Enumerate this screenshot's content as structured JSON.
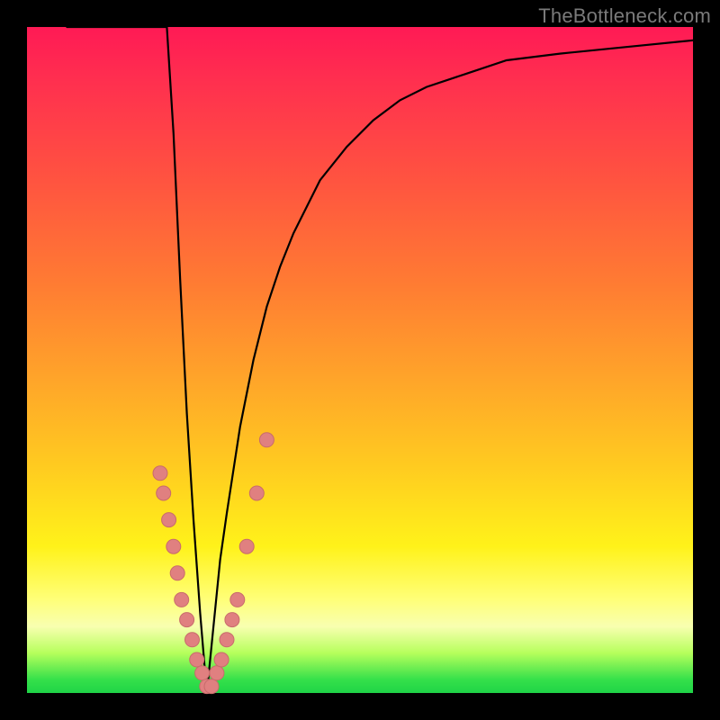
{
  "watermark": "TheBottleneck.com",
  "colors": {
    "curve": "#000000",
    "dot_fill": "#e08080",
    "dot_stroke": "#c86b6b",
    "gradient_stops": [
      "#ff1a55",
      "#ff5141",
      "#ff7a33",
      "#ffa22a",
      "#ffcb20",
      "#fff21a",
      "#ffff79",
      "#b6ff5c",
      "#1fd447"
    ]
  },
  "chart_data": {
    "type": "line",
    "title": "",
    "xlabel": "",
    "ylabel": "",
    "xlim": [
      0,
      100
    ],
    "ylim": [
      0,
      100
    ],
    "x_min_at": 27,
    "curve": {
      "description": "V-shaped bottleneck curve. Height = 100 * |1 - (x_min / x)^3| clamped to [0,100]. Minimum (y=0) near x≈27.",
      "samples_x": [
        6,
        8,
        10,
        12,
        14,
        16,
        18,
        20,
        21,
        22,
        23,
        24,
        25,
        26,
        27,
        28,
        29,
        30,
        32,
        34,
        36,
        38,
        40,
        44,
        48,
        52,
        56,
        60,
        66,
        72,
        80,
        90,
        100
      ],
      "samples_y": [
        100,
        100,
        100,
        100,
        100,
        100,
        100,
        100,
        100,
        84,
        62,
        42,
        26,
        12,
        0,
        10,
        20,
        27,
        40,
        50,
        58,
        64,
        69,
        77,
        82,
        86,
        89,
        91,
        93,
        95,
        96,
        97,
        98
      ]
    },
    "series": [
      {
        "name": "data-points",
        "marker": "circle",
        "color": "#e08080",
        "points_x": [
          20.0,
          20.5,
          21.3,
          22.0,
          22.6,
          23.2,
          24.0,
          24.8,
          25.5,
          26.3,
          27.0,
          27.7,
          28.5,
          29.2,
          30.0,
          30.8,
          31.6,
          33.0,
          34.5,
          36.0
        ],
        "points_y": [
          33,
          30,
          26,
          22,
          18,
          14,
          11,
          8,
          5,
          3,
          1,
          1,
          3,
          5,
          8,
          11,
          14,
          22,
          30,
          38
        ]
      }
    ]
  }
}
